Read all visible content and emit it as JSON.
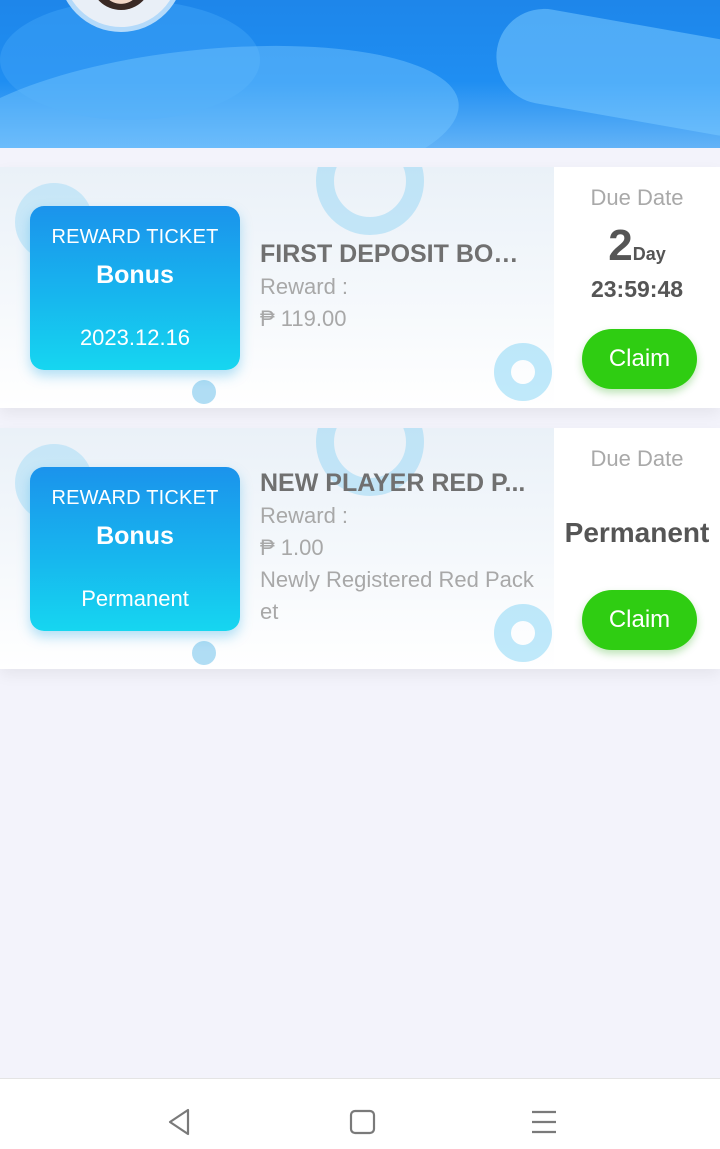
{
  "tickets": [
    {
      "ticket_label": "REWARD TICKET",
      "ticket_type": "Bonus",
      "ticket_date": "2023.12.16",
      "title": "FIRST DEPOSIT BON...",
      "reward_label": "Reward :",
      "reward_amount": "₱ 119.00",
      "due_label": "Due Date",
      "due_days": "2",
      "due_unit": "Day",
      "due_time": "23:59:48",
      "claim_label": "Claim"
    },
    {
      "ticket_label": "REWARD TICKET",
      "ticket_type": "Bonus",
      "ticket_date": "Permanent",
      "title": "NEW PLAYER RED P...",
      "reward_label": "Reward :",
      "reward_amount": "₱ 1.00",
      "description": "Newly Registered Red Packet",
      "due_label": "Due Date",
      "due_value": "Permanent",
      "claim_label": "Claim"
    }
  ],
  "nav": {
    "icons": [
      "back-icon",
      "home-icon",
      "menu-icon"
    ]
  },
  "colors": {
    "header_blue": "#1f8ef2",
    "ticket_gradient_top": "#1b93ec",
    "ticket_gradient_bottom": "#16d6f0",
    "claim_green": "#2fcd12"
  }
}
